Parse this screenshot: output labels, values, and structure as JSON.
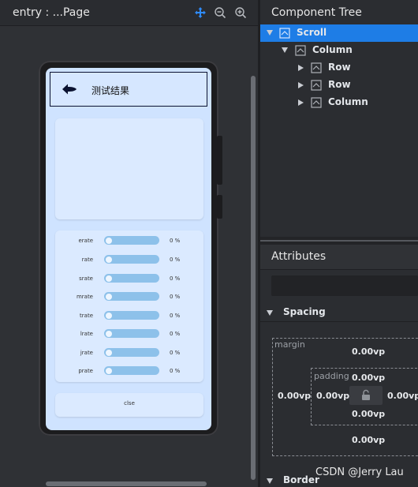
{
  "preview": {
    "title": "entry : ...Page",
    "tools": [
      "move-icon",
      "zoom-out-icon",
      "zoom-in-icon"
    ]
  },
  "app_screen": {
    "header_title": "测试结果",
    "rates": [
      {
        "label": "erate",
        "value": "0 %"
      },
      {
        "label": "rate",
        "value": "0 %"
      },
      {
        "label": "srate",
        "value": "0 %"
      },
      {
        "label": "mrate",
        "value": "0 %"
      },
      {
        "label": "trate",
        "value": "0 %"
      },
      {
        "label": "lrate",
        "value": "0 %"
      },
      {
        "label": "jrate",
        "value": "0 %"
      },
      {
        "label": "prate",
        "value": "0 %"
      }
    ],
    "button_label": "clse"
  },
  "component_tree": {
    "title": "Component Tree",
    "nodes": [
      {
        "label": "Scroll",
        "expanded": true,
        "selected": true
      },
      {
        "label": "Column",
        "expanded": true,
        "selected": false
      },
      {
        "label": "Row",
        "expanded": false,
        "selected": false
      },
      {
        "label": "Row",
        "expanded": false,
        "selected": false
      },
      {
        "label": "Column",
        "expanded": false,
        "selected": false
      }
    ]
  },
  "attributes": {
    "title": "Attributes",
    "sections": {
      "spacing": "Spacing",
      "border": "Border"
    },
    "spacing": {
      "margin_label": "margin",
      "padding_label": "padding",
      "margin_top": "0.00vp",
      "margin_left": "0.00vp",
      "margin_bottom": "0.00vp",
      "padding_top": "0.00vp",
      "padding_left": "0.00vp",
      "padding_right": "0.00vp",
      "padding_bottom": "0.00vp"
    }
  },
  "watermark": "CSDN @Jerry Lau",
  "colors": {
    "selected_row": "#1e7de6",
    "rate_track": "#8dc1ea",
    "screen_bg": "#cfe3ff"
  }
}
